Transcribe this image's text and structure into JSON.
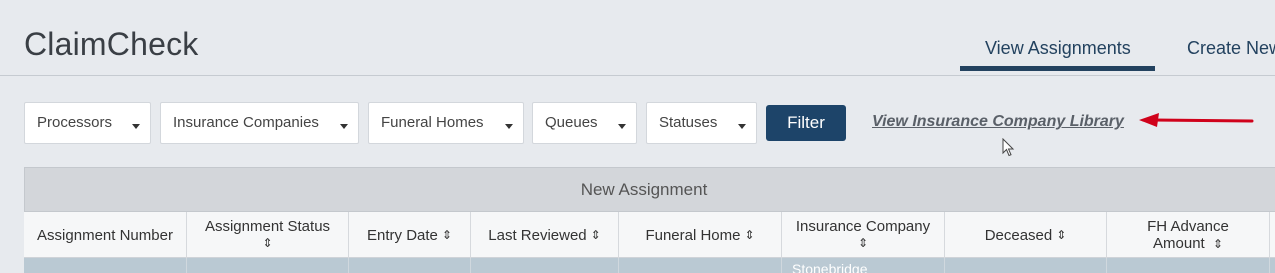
{
  "app": {
    "title": "ClaimCheck"
  },
  "nav": {
    "tabs": [
      {
        "label": "View Assignments",
        "active": true
      },
      {
        "label": "Create New",
        "active": false
      }
    ]
  },
  "filters": {
    "dropdowns": [
      {
        "label": "Processors"
      },
      {
        "label": "Insurance Companies"
      },
      {
        "label": "Funeral Homes"
      },
      {
        "label": "Queues"
      },
      {
        "label": "Statuses"
      }
    ],
    "filter_button": "Filter",
    "library_link": "View Insurance Company Library"
  },
  "annotation": {
    "arrow_color": "#d0021b"
  },
  "table": {
    "group_header": "New Assignment",
    "columns": [
      {
        "label": "Assignment Number",
        "sortable": false
      },
      {
        "label": "Assignment Status",
        "sortable": true
      },
      {
        "label": "Entry Date",
        "sortable": true
      },
      {
        "label": "Last Reviewed",
        "sortable": true
      },
      {
        "label": "Funeral Home",
        "sortable": true
      },
      {
        "label": "Insurance Company",
        "sortable": true
      },
      {
        "label": "Deceased",
        "sortable": true
      },
      {
        "label": "FH Advance Amount",
        "sortable": true
      }
    ],
    "rows": [
      {
        "insurance_company": "Stonebridge"
      }
    ]
  },
  "colors": {
    "primary": "#1d4469",
    "nav_text": "#23425f",
    "background": "#e7eaee",
    "row_selected": "#bac9d3"
  }
}
